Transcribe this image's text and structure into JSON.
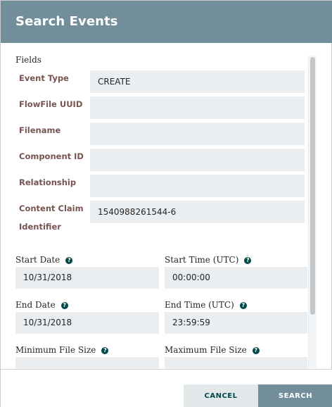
{
  "dialog": {
    "title": "Search Events"
  },
  "fields": {
    "section_label": "Fields",
    "items": [
      {
        "label": "Event Type",
        "value": "CREATE"
      },
      {
        "label": "FlowFile UUID",
        "value": ""
      },
      {
        "label": "Filename",
        "value": ""
      },
      {
        "label": "Component ID",
        "value": ""
      },
      {
        "label": "Relationship",
        "value": ""
      },
      {
        "label": "Content Claim",
        "label_line2": "Identifier",
        "value": "1540988261544-6"
      }
    ]
  },
  "dates": {
    "start_date_label": "Start Date",
    "start_date_value": "10/31/2018",
    "start_time_label": "Start Time (UTC)",
    "start_time_value": "00:00:00",
    "end_date_label": "End Date",
    "end_date_value": "10/31/2018",
    "end_time_label": "End Time (UTC)",
    "end_time_value": "23:59:59",
    "min_size_label": "Minimum File Size",
    "min_size_value": "",
    "max_size_label": "Maximum File Size",
    "max_size_value": "",
    "help_glyph": "?"
  },
  "buttons": {
    "cancel_label": "CANCEL",
    "search_label": "SEARCH"
  },
  "colors": {
    "header": "#728e9b",
    "field_label": "#775351",
    "input_bg": "#eaeef0",
    "help_icon": "#004849"
  }
}
